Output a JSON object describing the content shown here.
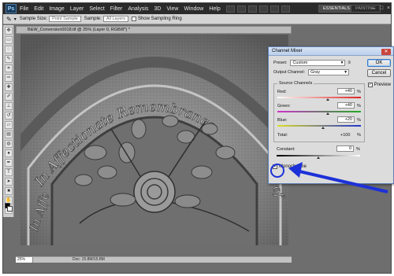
{
  "menubar": {
    "logo": "Ps",
    "items": [
      "File",
      "Edit",
      "Image",
      "Layer",
      "Select",
      "Filter",
      "Analysis",
      "3D",
      "View",
      "Window",
      "Help"
    ],
    "workspaces": [
      "ESSENTIALS",
      "PAINTING"
    ]
  },
  "options": {
    "sample_size_label": "Sample Size:",
    "sample_size_value": "Point Sample",
    "sample_label": "Sample:",
    "sample_value": "All Layers",
    "show_ring_label": "Show Sampling Ring"
  },
  "document": {
    "tab_title": "B&W_Conversion0018.tif @ 25% (Layer 0, RGB/8*) *",
    "zoom": "25%",
    "info": "Doc: 15.8M/15.8M",
    "carved_text_top": "In Affectionate Remembrance",
    "carved_text_left": "In Affe",
    "carved_text_right": "of"
  },
  "dialog": {
    "title": "Channel Mixer",
    "preset_label": "Preset:",
    "preset_value": "Custom",
    "output_label": "Output Channel:",
    "output_value": "Gray",
    "source_group": "Source Channels",
    "channels": [
      {
        "label": "Red:",
        "value": "+40",
        "unit": "%",
        "level": 40,
        "color": "#d22"
      },
      {
        "label": "Green:",
        "value": "+40",
        "unit": "%",
        "level": 40,
        "color": "#2a2"
      },
      {
        "label": "Blue:",
        "value": "+20",
        "unit": "%",
        "level": 20,
        "color": "#23c"
      }
    ],
    "total_label": "Total:",
    "total_value": "+100",
    "total_unit": "%",
    "constant_label": "Constant:",
    "constant_value": "0",
    "constant_unit": "%",
    "constant_level": 0,
    "monochrome_label": "Monochrome",
    "monochrome_checked": true,
    "ok_label": "OK",
    "cancel_label": "Cancel",
    "preview_label": "Preview",
    "preview_checked": true
  },
  "colors": {
    "annotation": "#1d31d8"
  }
}
